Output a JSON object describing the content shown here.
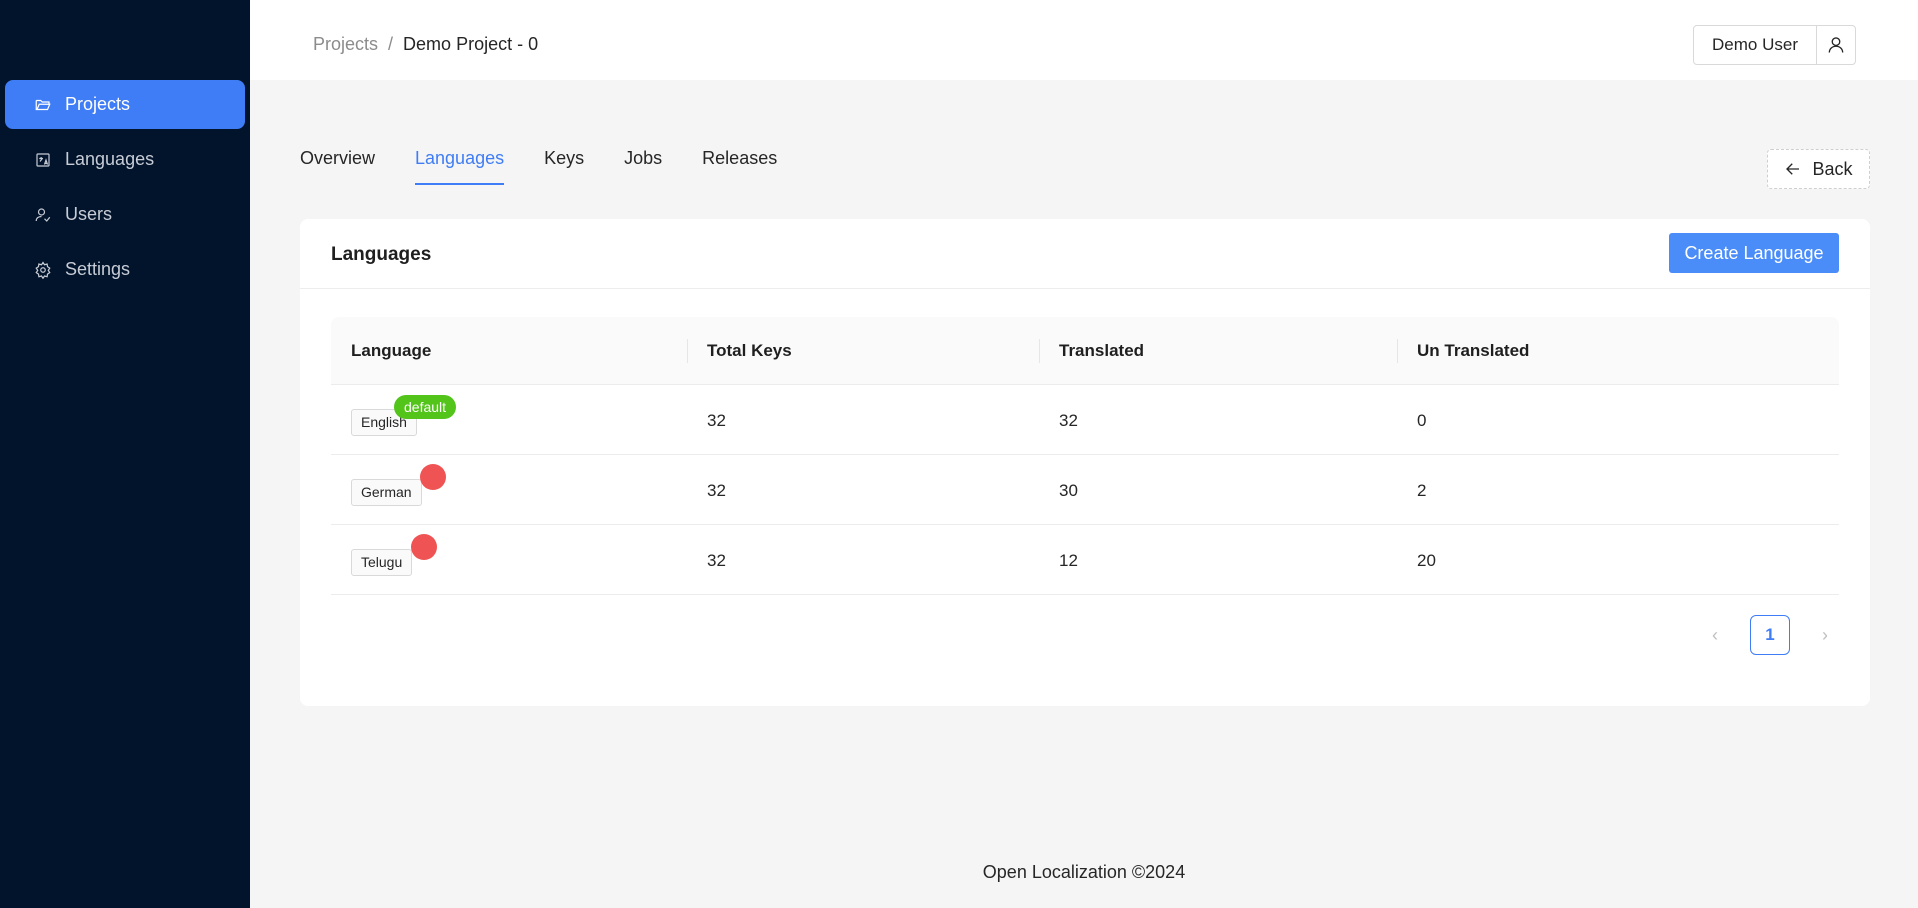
{
  "sidebar": {
    "items": [
      {
        "label": "Projects",
        "icon": "folder-open-icon",
        "active": true
      },
      {
        "label": "Languages",
        "icon": "languages-icon",
        "active": false
      },
      {
        "label": "Users",
        "icon": "users-icon",
        "active": false
      },
      {
        "label": "Settings",
        "icon": "gear-icon",
        "active": false
      }
    ]
  },
  "header": {
    "breadcrumb": {
      "parent": "Projects",
      "separator": "/",
      "current": "Demo Project - 0"
    },
    "user": {
      "name": "Demo User",
      "icon": "user-icon"
    }
  },
  "tabs": [
    {
      "label": "Overview",
      "active": false
    },
    {
      "label": "Languages",
      "active": true
    },
    {
      "label": "Keys",
      "active": false
    },
    {
      "label": "Jobs",
      "active": false
    },
    {
      "label": "Releases",
      "active": false
    }
  ],
  "back_button": {
    "label": "Back",
    "icon": "arrow-left-icon"
  },
  "card": {
    "title": "Languages",
    "create_button": "Create Language"
  },
  "table": {
    "columns": [
      "Language",
      "Total Keys",
      "Translated",
      "Un Translated"
    ],
    "rows": [
      {
        "language": "English",
        "badge": "default",
        "total": "32",
        "translated": "32",
        "untranslated": "0"
      },
      {
        "language": "German",
        "badge": "",
        "total": "32",
        "translated": "30",
        "untranslated": "2"
      },
      {
        "language": "Telugu",
        "badge": "",
        "total": "32",
        "translated": "12",
        "untranslated": "20"
      }
    ]
  },
  "pagination": {
    "current_page": "1",
    "prev": "‹",
    "next": "›"
  },
  "footer": {
    "text": "Open Localization ©2024"
  },
  "colors": {
    "sidebar_bg": "#02142b",
    "accent": "#3f7df6",
    "default_badge": "#52c41a",
    "status_dot": "#ef5353"
  }
}
